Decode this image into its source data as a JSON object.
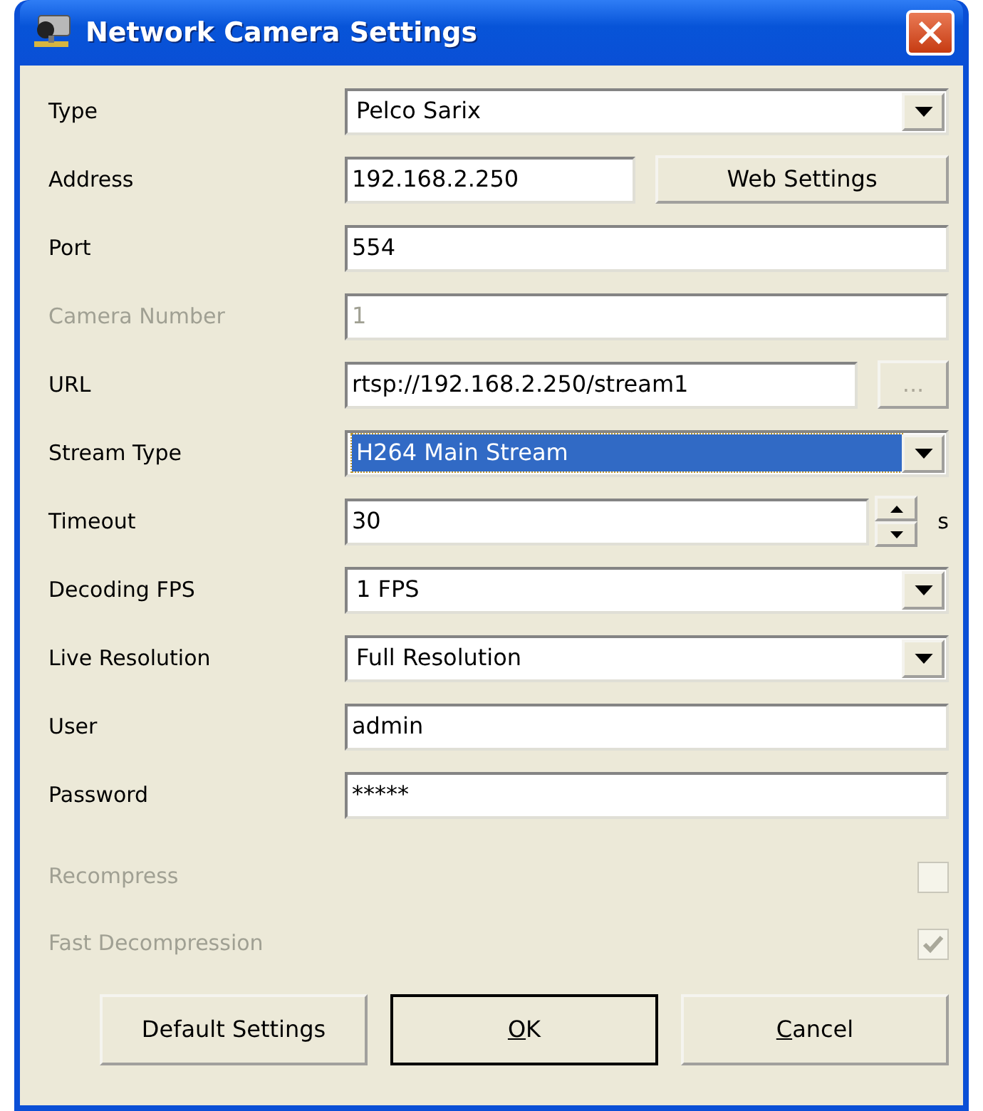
{
  "window": {
    "title": "Network Camera Settings"
  },
  "fields": [
    {
      "kind": "select",
      "label": "Type",
      "value": "Pelco Sarix",
      "disabled": false,
      "focused": false
    },
    {
      "kind": "text-button",
      "label": "Address",
      "value": "192.168.2.250",
      "button": "Web Settings",
      "button_disabled": false,
      "disabled": false,
      "focused": false
    },
    {
      "kind": "text",
      "label": "Port",
      "value": "554",
      "disabled": false,
      "focused": false
    },
    {
      "kind": "text",
      "label": "Camera Number",
      "value": "1",
      "disabled": true,
      "focused": false
    },
    {
      "kind": "text-button",
      "label": "URL",
      "value": "rtsp://192.168.2.250/stream1",
      "button": "...",
      "button_disabled": true,
      "disabled": false,
      "focused": false
    },
    {
      "kind": "select",
      "label": "Stream Type",
      "value": "H264 Main Stream",
      "disabled": false,
      "focused": true
    },
    {
      "kind": "spin",
      "label": "Timeout",
      "value": "30",
      "unit": "s",
      "disabled": false,
      "focused": false
    },
    {
      "kind": "select",
      "label": "Decoding FPS",
      "value": "1 FPS",
      "disabled": false,
      "focused": false
    },
    {
      "kind": "select",
      "label": "Live Resolution",
      "value": "Full Resolution",
      "disabled": false,
      "focused": false
    },
    {
      "kind": "text",
      "label": "User",
      "value": "admin",
      "disabled": false,
      "focused": false
    },
    {
      "kind": "text",
      "label": "Password",
      "value": "*****",
      "disabled": false,
      "focused": false
    }
  ],
  "checkboxes": [
    {
      "label": "Recompress",
      "checked": false,
      "disabled": true
    },
    {
      "label": "Fast Decompression",
      "checked": true,
      "disabled": true
    }
  ],
  "buttons": [
    {
      "label": "Default Settings",
      "default": false,
      "accel_first": false
    },
    {
      "label": "OK",
      "default": true,
      "accel_first": true
    },
    {
      "label": "Cancel",
      "default": false,
      "accel_first": true
    }
  ]
}
